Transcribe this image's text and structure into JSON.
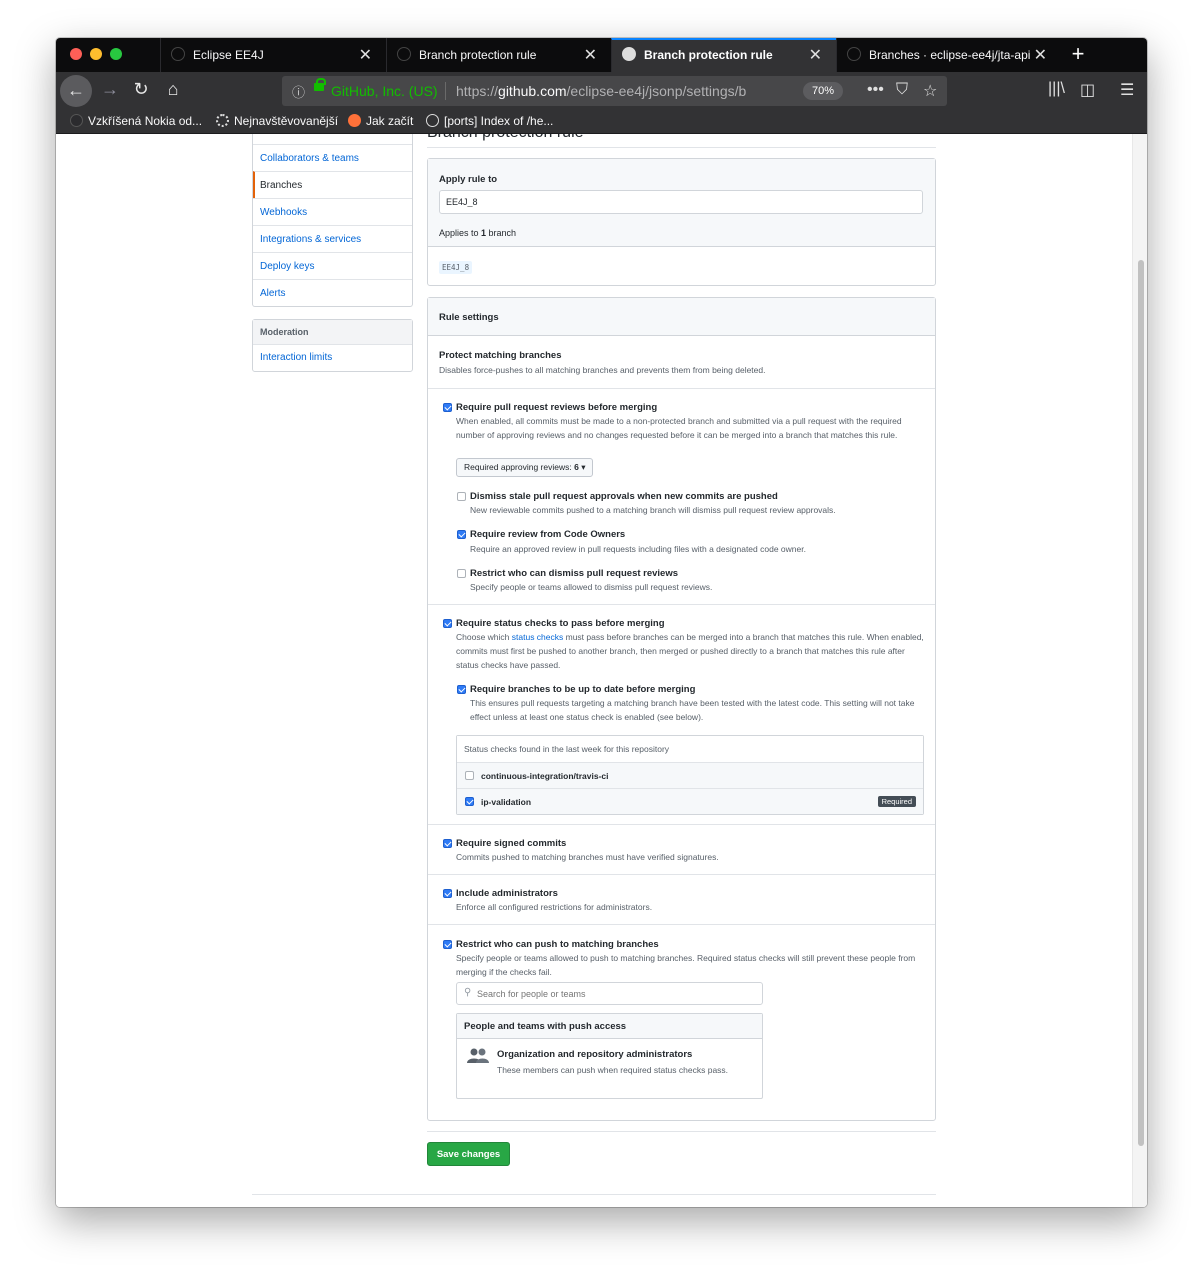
{
  "browser": {
    "tabs": [
      {
        "title": "Eclipse EE4J",
        "active": false
      },
      {
        "title": "Branch protection rule",
        "active": false
      },
      {
        "title": "Branch protection rule",
        "active": true
      },
      {
        "title": "Branches · eclipse-ee4j/jta-api",
        "active": false
      }
    ],
    "url": {
      "org": "GitHub, Inc. (US)",
      "prefix": "https://",
      "host": "github.com",
      "path": "/eclipse-ee4j/jsonp/settings/b",
      "zoom": "70%"
    },
    "bookmarks": [
      "Vzkříšená Nokia od...",
      "Nejnavštěvovanější",
      "Jak začít",
      "[ports] Index of /he..."
    ]
  },
  "sidebar": {
    "items": [
      {
        "label": "Collaborators & teams",
        "selected": false
      },
      {
        "label": "Branches",
        "selected": true
      },
      {
        "label": "Webhooks",
        "selected": false
      },
      {
        "label": "Integrations & services",
        "selected": false
      },
      {
        "label": "Deploy keys",
        "selected": false
      },
      {
        "label": "Alerts",
        "selected": false
      }
    ],
    "moderation": {
      "heading": "Moderation",
      "items": [
        {
          "label": "Interaction limits"
        }
      ]
    }
  },
  "page": {
    "title_partial": "Branch protection rule"
  },
  "apply_rule": {
    "label": "Apply rule to",
    "value": "EE4J_8",
    "applies_prefix": "Applies to ",
    "applies_count": "1",
    "applies_suffix": " branch",
    "matched_branch": "EE4J_8"
  },
  "rule_settings": {
    "heading": "Rule settings",
    "protect_title": "Protect matching branches",
    "protect_desc": "Disables force-pushes to all matching branches and prevents them from being deleted.",
    "pr_reviews": {
      "checked": true,
      "title": "Require pull request reviews before merging",
      "desc": "When enabled, all commits must be made to a non-protected branch and submitted via a pull request with the required number of approving reviews and no changes requested before it can be merged into a branch that matches this rule.",
      "select_label": "Required approving reviews: ",
      "select_value": "6",
      "options": [
        {
          "checked": false,
          "title": "Dismiss stale pull request approvals when new commits are pushed",
          "desc": "New reviewable commits pushed to a matching branch will dismiss pull request review approvals."
        },
        {
          "checked": true,
          "title": "Require review from Code Owners",
          "desc": "Require an approved review in pull requests including files with a designated code owner."
        },
        {
          "checked": false,
          "title": "Restrict who can dismiss pull request reviews",
          "desc": "Specify people or teams allowed to dismiss pull request reviews."
        }
      ]
    },
    "status_checks": {
      "checked": true,
      "title": "Require status checks to pass before merging",
      "desc_pre": "Choose which ",
      "desc_link": "status checks",
      "desc_post": " must pass before branches can be merged into a branch that matches this rule. When enabled, commits must first be pushed to another branch, then merged or pushed directly to a branch that matches this rule after status checks have passed.",
      "up_to_date": {
        "checked": true,
        "title": "Require branches to be up to date before merging",
        "desc": "This ensures pull requests targeting a matching branch have been tested with the latest code. This setting will not take effect unless at least one status check is enabled (see below)."
      },
      "found_heading": "Status checks found in the last week for this repository",
      "checks": [
        {
          "name": "continuous-integration/travis-ci",
          "checked": false,
          "required_label": ""
        },
        {
          "name": "ip-validation",
          "checked": true,
          "required_label": "Required"
        }
      ]
    },
    "signed_commits": {
      "checked": true,
      "title": "Require signed commits",
      "desc": "Commits pushed to matching branches must have verified signatures."
    },
    "include_admins": {
      "checked": true,
      "title": "Include administrators",
      "desc": "Enforce all configured restrictions for administrators."
    },
    "restrict_push": {
      "checked": true,
      "title": "Restrict who can push to matching branches",
      "desc": "Specify people or teams allowed to push to matching branches. Required status checks will still prevent these people from merging if the checks fail.",
      "search_placeholder": "Search for people or teams",
      "people_heading": "People and teams with push access",
      "entry_title": "Organization and repository administrators",
      "entry_desc": "These members can push when required status checks pass."
    }
  },
  "save_button": "Save changes",
  "colors": {
    "primary_green": "#28a745",
    "link_blue": "#0366d6",
    "checkbox_blue": "#2f7bf6",
    "selected_accent": "#e36209"
  },
  "icons": [
    "back-arrow-icon",
    "forward-arrow-icon",
    "reload-icon",
    "home-icon",
    "info-icon",
    "lock-icon",
    "more-icon",
    "pocket-icon",
    "star-icon",
    "library-icon",
    "sidebar-icon",
    "hamburger-menu-icon",
    "search-icon",
    "people-icon"
  ]
}
